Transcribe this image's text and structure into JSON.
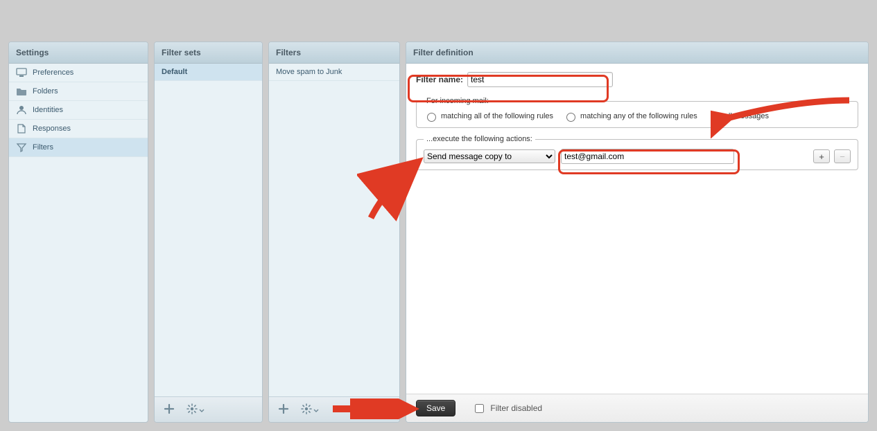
{
  "settings": {
    "header": "Settings",
    "items": [
      {
        "label": "Preferences",
        "icon": "monitor-icon"
      },
      {
        "label": "Folders",
        "icon": "folder-icon"
      },
      {
        "label": "Identities",
        "icon": "person-icon"
      },
      {
        "label": "Responses",
        "icon": "document-icon"
      },
      {
        "label": "Filters",
        "icon": "funnel-icon",
        "selected": true
      }
    ]
  },
  "filtersets": {
    "header": "Filter sets",
    "items": [
      {
        "label": "Default",
        "selected": true
      }
    ]
  },
  "filters": {
    "header": "Filters",
    "items": [
      {
        "label": "Move spam to Junk"
      }
    ]
  },
  "definition": {
    "header": "Filter definition",
    "name_label": "Filter name:",
    "name_value": "test",
    "scope_legend": "For incoming mail:",
    "scope_options": {
      "all_rules": "matching all of the following rules",
      "any_rules": "matching any of the following rules",
      "all_msgs": "all messages"
    },
    "scope_selected": "all_msgs",
    "actions_legend": "...execute the following actions:",
    "action_select": "Send message copy to",
    "action_target": "test@gmail.com",
    "add_label": "+",
    "remove_label": "−",
    "save_label": "Save",
    "disabled_label": "Filter disabled",
    "disabled_checked": false
  }
}
